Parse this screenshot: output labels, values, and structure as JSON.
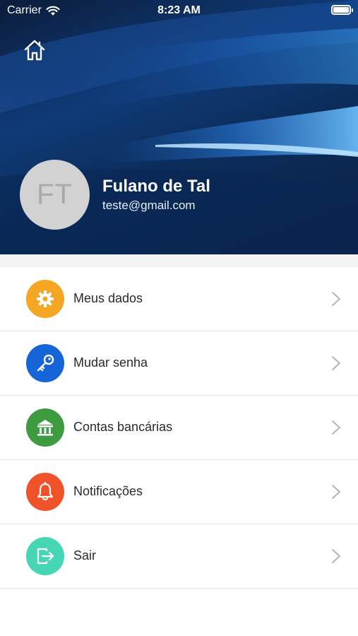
{
  "status_bar": {
    "carrier": "Carrier",
    "time": "8:23 AM"
  },
  "profile": {
    "initials": "FT",
    "name": "Fulano de Tal",
    "email": "teste@gmail.com"
  },
  "menu": {
    "items": [
      {
        "label": "Meus dados",
        "icon": "gear-icon",
        "color": "#f5a623"
      },
      {
        "label": "Mudar senha",
        "icon": "key-icon",
        "color": "#1565d8"
      },
      {
        "label": "Contas bancárias",
        "icon": "bank-icon",
        "color": "#3f9b3f"
      },
      {
        "label": "Notificações",
        "icon": "bell-icon",
        "color": "#f0522a"
      },
      {
        "label": "Sair",
        "icon": "exit-icon",
        "color": "#46d6b5"
      }
    ]
  },
  "colors": {
    "header_background": "#0f3b78",
    "avatar_background": "#d2d2d2",
    "separator": "#f3f3f3"
  }
}
